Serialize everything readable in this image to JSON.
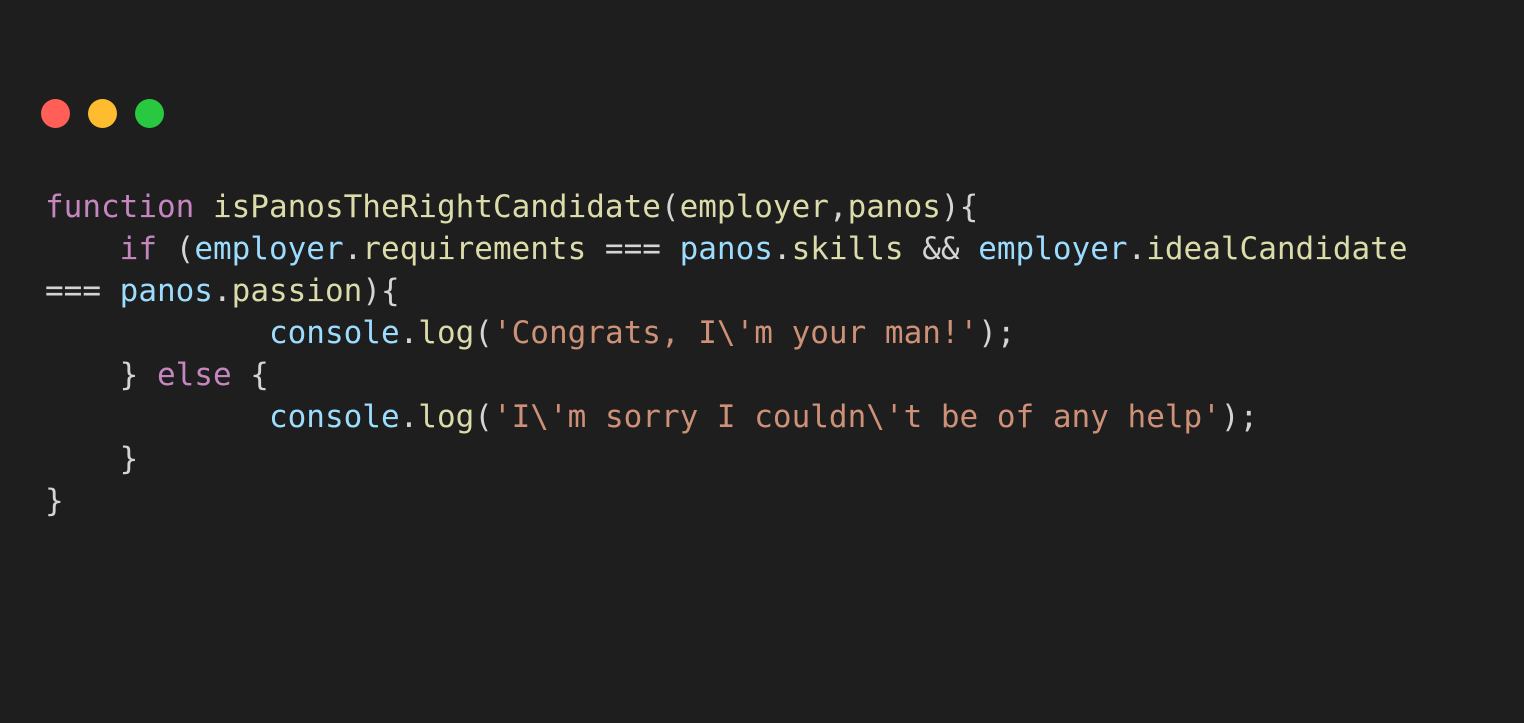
{
  "window": {
    "background": "#1e1e1e",
    "controls": [
      {
        "name": "close-button",
        "color": "#ff5f57"
      },
      {
        "name": "minimize-button",
        "color": "#febc2e"
      },
      {
        "name": "maximize-button",
        "color": "#28c840"
      }
    ]
  },
  "colors": {
    "keyword": "#c586c0",
    "function": "#dcdcaa",
    "variable": "#9cdcfe",
    "string": "#ce9178",
    "punctuation": "#d4d4d4"
  },
  "code": {
    "lines": [
      [
        {
          "text": "function",
          "kind": "keyword"
        },
        {
          "text": " ",
          "kind": "punctuation"
        },
        {
          "text": "isPanosTheRightCandidate",
          "kind": "function"
        },
        {
          "text": "(",
          "kind": "punctuation"
        },
        {
          "text": "employer",
          "kind": "function"
        },
        {
          "text": ",",
          "kind": "punctuation"
        },
        {
          "text": "panos",
          "kind": "function"
        },
        {
          "text": "){",
          "kind": "punctuation"
        }
      ],
      [
        {
          "text": "    ",
          "kind": "punctuation"
        },
        {
          "text": "if",
          "kind": "keyword"
        },
        {
          "text": " (",
          "kind": "punctuation"
        },
        {
          "text": "employer",
          "kind": "variable"
        },
        {
          "text": ".",
          "kind": "punctuation"
        },
        {
          "text": "requirements",
          "kind": "function"
        },
        {
          "text": " === ",
          "kind": "punctuation"
        },
        {
          "text": "panos",
          "kind": "variable"
        },
        {
          "text": ".",
          "kind": "punctuation"
        },
        {
          "text": "skills",
          "kind": "function"
        },
        {
          "text": " && ",
          "kind": "punctuation"
        },
        {
          "text": "employer",
          "kind": "variable"
        },
        {
          "text": ".",
          "kind": "punctuation"
        },
        {
          "text": "idealCandidate",
          "kind": "function"
        }
      ],
      [
        {
          "text": "=== ",
          "kind": "punctuation"
        },
        {
          "text": "panos",
          "kind": "variable"
        },
        {
          "text": ".",
          "kind": "punctuation"
        },
        {
          "text": "passion",
          "kind": "function"
        },
        {
          "text": "){",
          "kind": "punctuation"
        }
      ],
      [
        {
          "text": "            ",
          "kind": "punctuation"
        },
        {
          "text": "console",
          "kind": "variable"
        },
        {
          "text": ".",
          "kind": "punctuation"
        },
        {
          "text": "log",
          "kind": "function"
        },
        {
          "text": "(",
          "kind": "punctuation"
        },
        {
          "text": "'Congrats, I\\'m your man!'",
          "kind": "string"
        },
        {
          "text": ");",
          "kind": "punctuation"
        }
      ],
      [
        {
          "text": "    } ",
          "kind": "punctuation"
        },
        {
          "text": "else",
          "kind": "keyword"
        },
        {
          "text": " {",
          "kind": "punctuation"
        }
      ],
      [
        {
          "text": "            ",
          "kind": "punctuation"
        },
        {
          "text": "console",
          "kind": "variable"
        },
        {
          "text": ".",
          "kind": "punctuation"
        },
        {
          "text": "log",
          "kind": "function"
        },
        {
          "text": "(",
          "kind": "punctuation"
        },
        {
          "text": "'I\\'m sorry I couldn\\'t be of any help'",
          "kind": "string"
        },
        {
          "text": ");",
          "kind": "punctuation"
        }
      ],
      [
        {
          "text": "    }",
          "kind": "punctuation"
        }
      ],
      [
        {
          "text": "}",
          "kind": "punctuation"
        }
      ]
    ]
  }
}
